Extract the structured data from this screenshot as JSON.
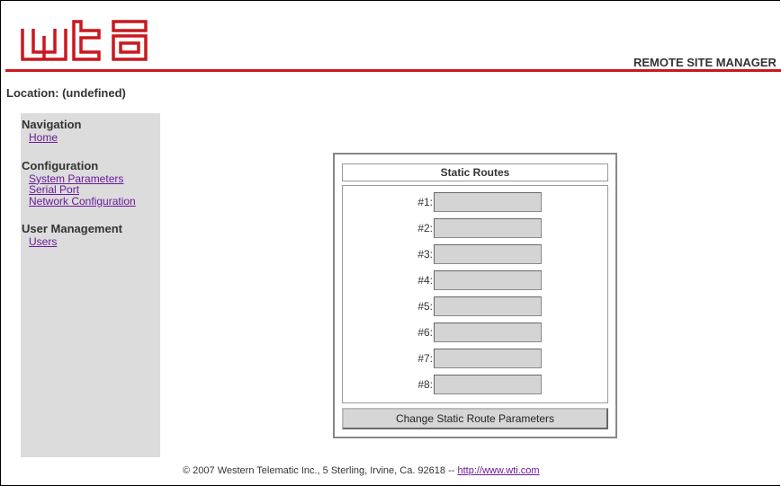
{
  "header": {
    "logo_alt": "wti",
    "product_name": "REMOTE SITE MANAGER",
    "brand_color": "#c8191e"
  },
  "location": "Location: (undefined)",
  "sidebar": {
    "sections": [
      {
        "title": "Navigation",
        "links": [
          "Home"
        ]
      },
      {
        "title": "Configuration",
        "links": [
          "System Parameters",
          "Serial Port",
          "Network Configuration"
        ]
      },
      {
        "title": "User Management",
        "links": [
          "Users"
        ]
      }
    ]
  },
  "form": {
    "title": "Static Routes",
    "routes": [
      {
        "label": "#1:",
        "value": ""
      },
      {
        "label": "#2:",
        "value": ""
      },
      {
        "label": "#3:",
        "value": ""
      },
      {
        "label": "#4:",
        "value": ""
      },
      {
        "label": "#5:",
        "value": ""
      },
      {
        "label": "#6:",
        "value": ""
      },
      {
        "label": "#7:",
        "value": ""
      },
      {
        "label": "#8:",
        "value": ""
      }
    ],
    "submit_label": "Change Static Route Parameters"
  },
  "footer": {
    "text": "© 2007 Western Telematic Inc., 5 Sterling, Irvine, Ca. 92618 -- ",
    "link": "http://www.wti.com"
  }
}
